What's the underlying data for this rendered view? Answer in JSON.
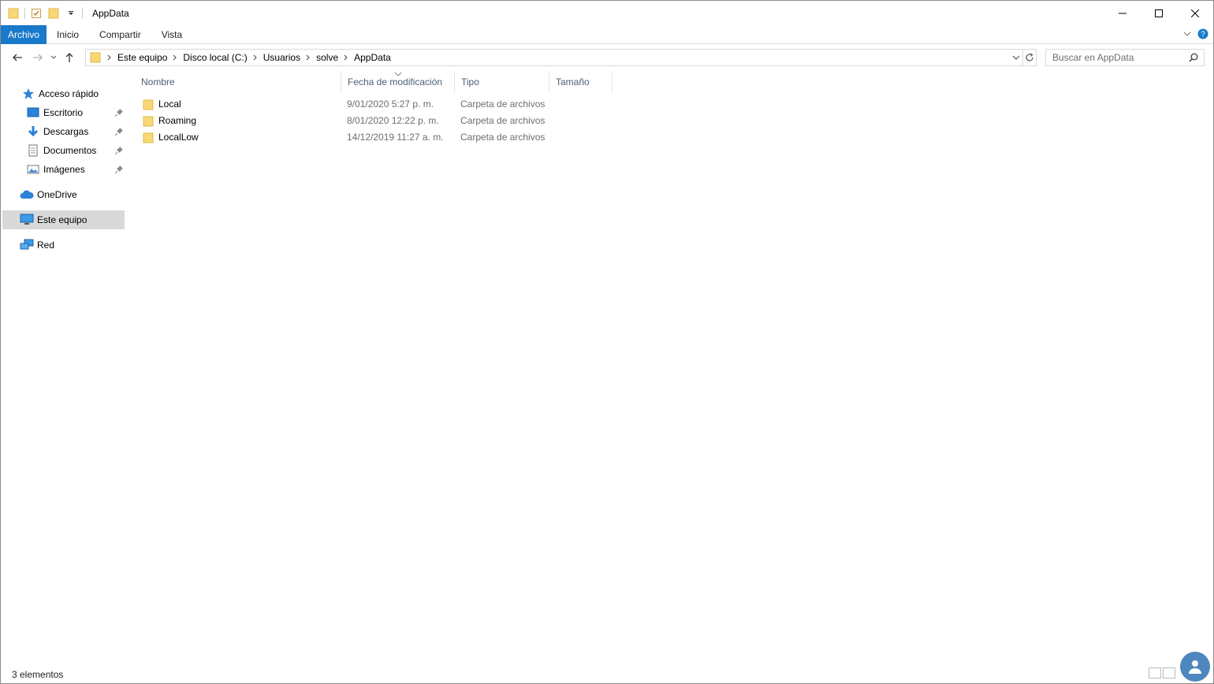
{
  "window": {
    "title": "AppData"
  },
  "ribbon": {
    "tabs": [
      {
        "label": "Archivo"
      },
      {
        "label": "Inicio"
      },
      {
        "label": "Compartir"
      },
      {
        "label": "Vista"
      }
    ]
  },
  "address": {
    "breadcrumbs": [
      "Este equipo",
      "Disco local (C:)",
      "Usuarios",
      "solve",
      "AppData"
    ]
  },
  "search": {
    "placeholder": "Buscar en AppData"
  },
  "nav": {
    "quick_access": "Acceso rápido",
    "pinned": [
      {
        "label": "Escritorio",
        "icon": "desktop-icon"
      },
      {
        "label": "Descargas",
        "icon": "download-icon"
      },
      {
        "label": "Documentos",
        "icon": "documents-icon"
      },
      {
        "label": "Imágenes",
        "icon": "pictures-icon"
      }
    ],
    "onedrive": "OneDrive",
    "this_pc": "Este equipo",
    "network": "Red"
  },
  "columns": {
    "name": "Nombre",
    "date": "Fecha de modificación",
    "type": "Tipo",
    "size": "Tamaño"
  },
  "files": [
    {
      "name": "Local",
      "date": "9/01/2020 5:27 p. m.",
      "type": "Carpeta de archivos",
      "size": ""
    },
    {
      "name": "Roaming",
      "date": "8/01/2020 12:22 p. m.",
      "type": "Carpeta de archivos",
      "size": ""
    },
    {
      "name": "LocalLow",
      "date": "14/12/2019 11:27 a. m.",
      "type": "Carpeta de archivos",
      "size": ""
    }
  ],
  "status": {
    "count": "3 elementos"
  },
  "colors": {
    "accent": "#1979ca",
    "folder": "#f8d775",
    "selected": "#d9d9d9"
  }
}
